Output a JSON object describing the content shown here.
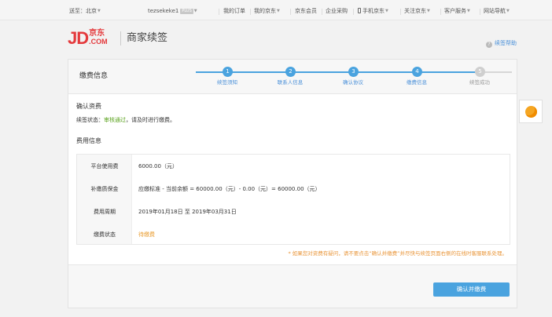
{
  "topbar": {
    "location_label": "送至：北京",
    "username": "tezsekeke1",
    "plus_badge": "PLUS",
    "links": [
      "我的订单",
      "我的京东",
      "京东会员",
      "企业采购",
      "手机京东",
      "关注京东",
      "客户服务",
      "网站导航"
    ]
  },
  "header": {
    "logo_jd": "JD",
    "logo_cn": "京东",
    "logo_com": ".COM",
    "title": "商家续签",
    "help_label": "续签帮助",
    "help_icon_glyph": "?"
  },
  "card": {
    "title": "缴费信息",
    "steps": [
      {
        "num": "1",
        "label": "续签须知",
        "active": true
      },
      {
        "num": "2",
        "label": "联系人信息",
        "active": true
      },
      {
        "num": "3",
        "label": "确认协议",
        "active": true
      },
      {
        "num": "4",
        "label": "缴费信息",
        "active": true
      },
      {
        "num": "5",
        "label": "续签成功",
        "active": false
      }
    ],
    "confirm_section_title": "确认资费",
    "status_prefix": "续签状态：",
    "status_value": "审核通过",
    "status_suffix": "，请及时进行缴费。",
    "fee_section_title": "费用信息",
    "fees": [
      {
        "label": "平台使用费",
        "value": "6000.00（元）"
      },
      {
        "label": "补缴质保金",
        "value": "应缴标准 - 当前余额 = 60000.00（元）- 0.00（元）= 60000.00（元）"
      },
      {
        "label": "费用周期",
        "value": "2019年01月18日 至 2019年03月31日"
      },
      {
        "label": "缴费状态",
        "value": "待缴费"
      }
    ],
    "note": "* 如果您对资费有疑问，请不要点击“确认并缴费”并尽快与续签页面右侧的在线时客服联系处理。",
    "confirm_button": "确认并缴费"
  },
  "colors": {
    "brand_red": "#e4393c",
    "accent_blue": "#4aa3df",
    "ok_green": "#5aa21c",
    "pending_orange": "#e99b2c"
  },
  "icons": {
    "side_widget": "customer-service-icon"
  }
}
